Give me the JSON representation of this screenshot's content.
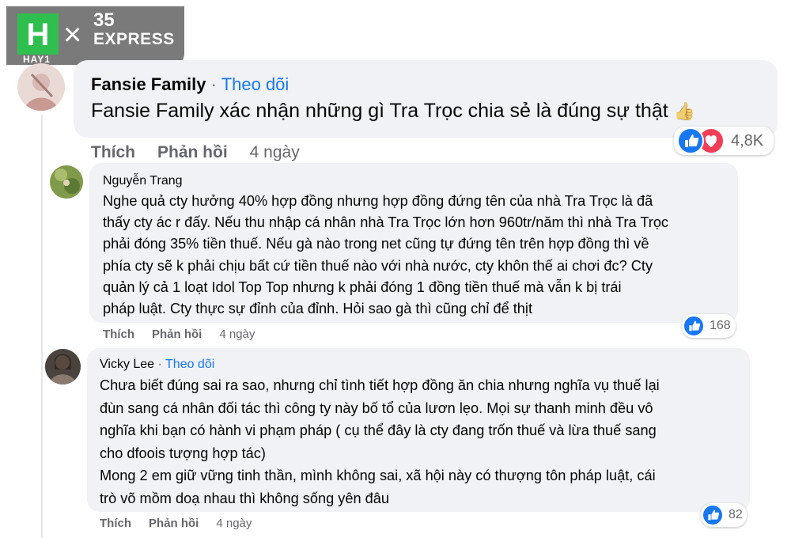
{
  "watermark": {
    "logo": "H",
    "sub": "HAY1",
    "cross": "×",
    "brand_num": "35",
    "brand_word": "EXPRESS"
  },
  "comments": [
    {
      "author": "Fansie Family",
      "follow": "Theo dõi",
      "text": "Fansie Family xác nhận những gì Tra Trọc chia sẻ là đúng sự thật",
      "emoji": "👍",
      "actions": {
        "like": "Thích",
        "reply": "Phản hồi",
        "time": "4 ngày"
      },
      "reactions": {
        "count": "4,8K",
        "types": [
          "like-icon",
          "love-icon"
        ]
      }
    },
    {
      "author": "Nguyễn Trang",
      "text": "Nghe quả cty hưởng 40% hợp đồng nhưng hợp đồng đứng tên của nhà Tra Trọc là đã\nthấy cty ác r đấy. Nếu thu nhập cá nhân nhà Tra Trọc lớn hơn 960tr/năm thì nhà Tra Trọc\nphải đóng 35% tiền thuế. Nếu gà nào trong net cũng tự đứng tên trên hợp đồng thì về\nphía cty sẽ k phải chịu bất cứ tiền thuế nào với nhà nước, cty khôn thế ai chơi đc? Cty\nquản lý cả 1 loạt Idol Top Top nhưng k phải đóng 1 đồng tiền thuế mà vẫn k bị trái\npháp luật. Cty thực sự đỉnh của đỉnh. Hỏi sao gà thì cũng chỉ để thịt",
      "actions": {
        "like": "Thích",
        "reply": "Phản hồi",
        "time": "4 ngày"
      },
      "reactions": {
        "count": "168",
        "types": [
          "like-icon"
        ]
      }
    },
    {
      "author": "Vicky Lee",
      "follow": "Theo dõi",
      "text": "Chưa biết đúng sai ra sao, nhưng chỉ tình tiết hợp đồng ăn chia nhưng nghĩa vụ thuế lại\nđùn sang cá nhân đối tác thì công ty này bố tổ của lươn lẹo. Mọi sự thanh minh đều vô\nnghĩa khi bạn có hành vi phạm pháp ( cụ thể đây là cty đang trốn thuế và lừa thuế sang\ncho dfoois tượng hợp tác)\nMong 2 em giữ vững tinh thần, mình không sai, xã hội này có thượng tôn pháp luật, cái\ntrò võ mồm doạ nhau thì không sống yên đâu",
      "actions": {
        "like": "Thích",
        "reply": "Phản hồi",
        "time": "4 ngày"
      },
      "reactions": {
        "count": "82",
        "types": [
          "like-icon"
        ]
      }
    }
  ],
  "colors": {
    "like": "#1877f2",
    "love": "#f33e58",
    "link": "#1877f2",
    "bubble": "#f0f2f5",
    "muted": "#65676b",
    "watermark": "#7a7a7a",
    "logo": "#2fbf4f"
  }
}
